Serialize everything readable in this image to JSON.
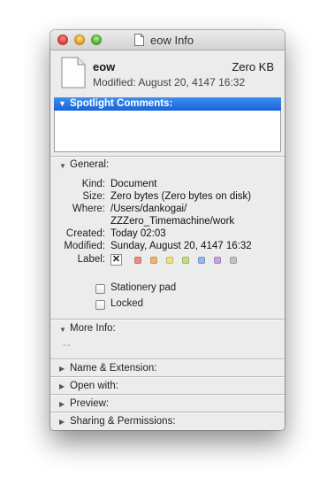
{
  "window": {
    "title": "eow Info"
  },
  "header": {
    "name": "eow",
    "size": "Zero KB",
    "modified": "Modified: August 20, 4147 16:32"
  },
  "spotlight": {
    "label": "Spotlight Comments:",
    "comment": ""
  },
  "general": {
    "label": "General:",
    "rows": [
      {
        "key": "Kind:",
        "value": "Document"
      },
      {
        "key": "Size:",
        "value": "Zero bytes (Zero bytes on disk)"
      },
      {
        "key": "Where:",
        "value": "/Users/dankogai/"
      },
      {
        "key": "",
        "value": "ZZZero_Timemachine/work"
      },
      {
        "key": "Created:",
        "value": "Today 02:03"
      },
      {
        "key": "Modified:",
        "value": "Sunday, August 20, 4147 16:32"
      }
    ],
    "label_row": {
      "key": "Label:",
      "none_glyph": "✕",
      "colors": [
        "#f08a80",
        "#f4b36a",
        "#efe07a",
        "#c2e07a",
        "#93b7ee",
        "#c9a3e3",
        "#c2c2c2"
      ]
    },
    "stationery": {
      "label": "Stationery pad",
      "checked": false
    },
    "locked": {
      "label": "Locked",
      "checked": false
    }
  },
  "more_info": {
    "label": "More Info:",
    "value": "--"
  },
  "sections": [
    {
      "label": "Name & Extension:"
    },
    {
      "label": "Open with:"
    },
    {
      "label": "Preview:"
    },
    {
      "label": "Sharing & Permissions:"
    }
  ],
  "icons": {
    "close": "close-button",
    "minimize": "minimize-button",
    "zoom": "zoom-button",
    "document": "document-icon",
    "disclosure_open": "▼",
    "disclosure_closed": "▶"
  }
}
